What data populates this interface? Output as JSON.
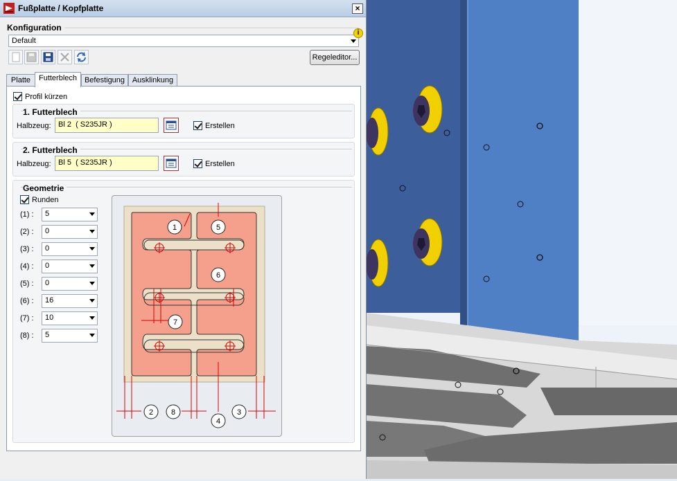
{
  "window": {
    "title": "Fußplatte / Kopfplatte",
    "close_label": "×"
  },
  "konfiguration": {
    "label": "Konfiguration",
    "selected": "Default",
    "info_icon": "info-icon",
    "regel_button": "Regeleditor..."
  },
  "toolbar": {
    "icons": [
      "new-icon",
      "save-icon",
      "save-as-icon",
      "delete-icon",
      "refresh-icon"
    ]
  },
  "tabs": [
    {
      "label": "Platte",
      "active": false
    },
    {
      "label": "Futterblech",
      "active": true
    },
    {
      "label": "Befestigung",
      "active": false
    },
    {
      "label": "Ausklinkung",
      "active": false
    }
  ],
  "profil_kuerzen": {
    "label": "Profil kürzen",
    "checked": true
  },
  "futterblech1": {
    "title": "1. Futterblech",
    "halbzeug_label": "Halbzeug:",
    "halbzeug_value": "Bl 2  ( S235JR )",
    "erstellen_label": "Erstellen",
    "erstellen_checked": true
  },
  "futterblech2": {
    "title": "2. Futterblech",
    "halbzeug_label": "Halbzeug:",
    "halbzeug_value": "Bl 5  ( S235JR )",
    "erstellen_label": "Erstellen",
    "erstellen_checked": true
  },
  "geometrie": {
    "title": "Geometrie",
    "runden_label": "Runden",
    "runden_checked": true,
    "params": [
      {
        "label": "(1) :",
        "value": "5"
      },
      {
        "label": "(2) :",
        "value": "0"
      },
      {
        "label": "(3) :",
        "value": "0"
      },
      {
        "label": "(4) :",
        "value": "0"
      },
      {
        "label": "(5) :",
        "value": "0"
      },
      {
        "label": "(6) :",
        "value": "16"
      },
      {
        "label": "(7) :",
        "value": "10"
      },
      {
        "label": "(8) :",
        "value": "5"
      }
    ],
    "diagram_numbers": [
      "1",
      "2",
      "3",
      "4",
      "5",
      "6",
      "7",
      "8"
    ]
  },
  "colors": {
    "plate_fill": "#f4a08c",
    "frame_fill": "#ede0c8",
    "dim_red": "#dd0000",
    "steel_blue": "#4f7fc4",
    "bolt_yellow": "#f0d000"
  }
}
